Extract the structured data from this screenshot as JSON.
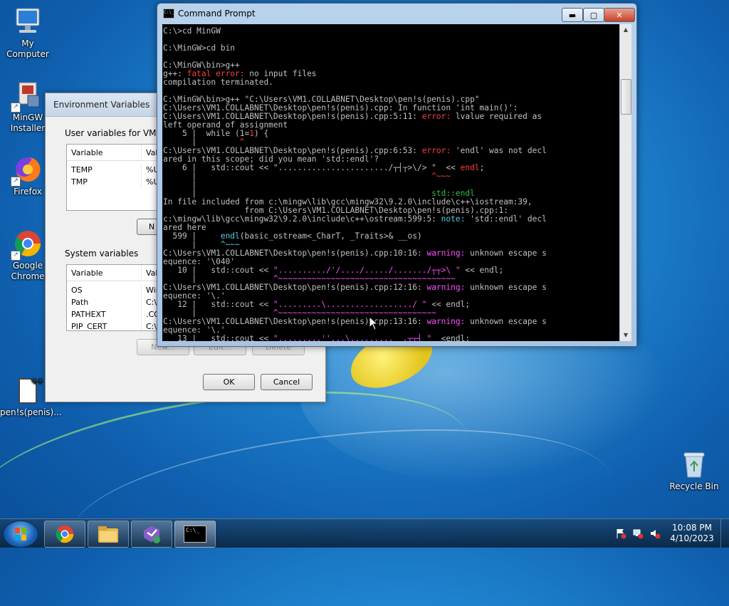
{
  "desktop": {
    "icons": [
      {
        "label": "My Computer"
      },
      {
        "label": "MinGW Installer"
      },
      {
        "label": "Firefox"
      },
      {
        "label": "Google Chrome"
      },
      {
        "label": "pen!s(penis)..."
      },
      {
        "label": "Recycle Bin"
      }
    ]
  },
  "env_dialog": {
    "title": "Environment Variables",
    "user_group_label": "User variables for VM1",
    "user_headers": [
      "Variable",
      "Valu"
    ],
    "user_rows": [
      {
        "name": "TEMP",
        "value": "%U"
      },
      {
        "name": "TMP",
        "value": "%U"
      }
    ],
    "user_new_button": "N",
    "system_group_label": "System variables",
    "system_headers": [
      "Variable",
      "Valu"
    ],
    "system_rows": [
      {
        "name": "OS",
        "value": "Win"
      },
      {
        "name": "Path",
        "value": "C:\\"
      },
      {
        "name": "PATHEXT",
        "value": ".CO"
      },
      {
        "name": "PIP_CERT",
        "value": "C:\\"
      }
    ],
    "system_buttons": [
      "New...",
      "Edit...",
      "Delete"
    ],
    "ok_label": "OK",
    "cancel_label": "Cancel"
  },
  "cmd": {
    "title": "Command Prompt",
    "icon_text": "C:\\_",
    "min_symbol": "▬",
    "max_symbol": "▢",
    "close_symbol": "✕",
    "line_01": "C:\\>cd MinGW",
    "line_02": "C:\\MinGW>cd bin",
    "line_03": "C:\\MinGW\\bin>g++",
    "line_04a": "g++: ",
    "line_04b": "fatal error: ",
    "line_04c": "no input files",
    "line_05": "compilation terminated.",
    "line_06": "C:\\MinGW\\bin>g++ \"C:\\Users\\VM1.COLLABNET\\Desktop\\pen!s(penis).cpp\"",
    "line_07": "C:\\Users\\VM1.COLLABNET\\Desktop\\pen!s(penis).cpp: In function 'int main()':",
    "line_08a": "C:\\Users\\VM1.COLLABNET\\Desktop\\pen!s(penis).cpp:5:11: ",
    "line_08b": "error: ",
    "line_08c": "lvalue required as",
    "line_09": "left operand of assignment",
    "line_10a": "    5 |  while (1=",
    "line_10b": "1",
    "line_10c": ") {",
    "line_11a": "      |         ",
    "line_11b": "^",
    "line_12a": "C:\\Users\\VM1.COLLABNET\\Desktop\\pen!s(penis).cpp:6:53: ",
    "line_12b": "error: ",
    "line_12c": "'endl' was not decl",
    "line_13": "ared in this scope; did you mean 'std::endl'?",
    "line_14a": "    6 |   std::cout << \"......................./┬┤┬>\\/> \"  << ",
    "line_14b": "endl",
    "line_14c": ";",
    "line_15a": "      |                                                 ",
    "line_15b": "^~~~",
    "line_16": "      |",
    "line_17a": "      |                                                 ",
    "line_17b": "std::endl",
    "line_18": "In file included from c:\\mingw\\lib\\gcc\\mingw32\\9.2.0\\include\\c++\\iostream:39,",
    "line_19": "                 from C:\\Users\\VM1.COLLABNET\\Desktop\\pen!s(penis).cpp:1:",
    "line_20a": "c:\\mingw\\lib\\gcc\\mingw32\\9.2.0\\include\\c++\\ostream:599:5: ",
    "line_20b": "note: ",
    "line_20c": "'std::endl' decl",
    "line_21": "ared here",
    "line_22a": "  599 |     ",
    "line_22b": "endl",
    "line_22c": "(basic_ostream<_CharT, _Traits>& __os)",
    "line_23a": "      |     ",
    "line_23b": "^~~~",
    "line_24a": "C:\\Users\\VM1.COLLABNET\\Desktop\\pen!s(penis).cpp:10:16: ",
    "line_24b": "warning: ",
    "line_24c": "unknown escape s",
    "line_25": "equence: '\\040'",
    "line_26a": "   10 |   std::cout << ",
    "line_26b": "\"........../'/..../...../......./┬┬>\\ \"",
    "line_26c": " << endl;",
    "line_27a": "      |                ",
    "line_27b": "^~~~~~~~~~~~~~~~~~~~~~~~~~~~~~~~~~~~~~",
    "line_28a": "C:\\Users\\VM1.COLLABNET\\Desktop\\pen!s(penis).cpp:12:16: ",
    "line_28b": "warning: ",
    "line_28c": "unknown escape s",
    "line_29": "equence: '\\.'",
    "line_30a": "   12 |   std::cout << ",
    "line_30b": "\".........\\................../ \"",
    "line_30c": " << endl;",
    "line_31a": "      |                ",
    "line_31b": "^~~~~~~~~~~~~~~~~~~~~~~~~~~~~~~~~~",
    "line_32a": "C:\\Users\\VM1.COLLABNET\\Desktop\\pen!s(penis).cpp:13:16: ",
    "line_32b": "warning: ",
    "line_32c": "unknown escape s",
    "line_33": "equence: '\\.'",
    "line_34a": "   13 |   std::cout << ",
    "line_34b": "\".........''...\\......... _.┬┬┤ \"",
    "line_34c": "  <endl;",
    "scroll_up": "▲",
    "scroll_down": "▼"
  },
  "taskbar": {
    "clock_time": "10:08 PM",
    "clock_date": "4/10/2023",
    "cmd_button_text": "C:\\_"
  }
}
